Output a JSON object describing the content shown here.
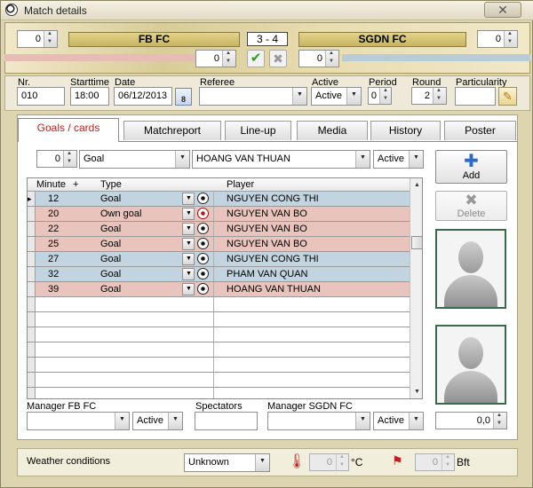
{
  "window": {
    "title": "Match details",
    "close_label": "✕"
  },
  "score": {
    "home_team": "FB FC",
    "away_team": "SGDN FC",
    "score_text": "3  - 4",
    "home_left_spin": "0",
    "away_right_spin": "0",
    "home_sub_spin": "0",
    "away_sub_spin": "0",
    "ok_icon": "✔",
    "cancel_icon": "✖"
  },
  "info": {
    "nr_label": "Nr.",
    "nr_value": "010",
    "starttime_label": "Starttime",
    "starttime_value": "18:00",
    "date_label": "Date",
    "date_value": "06/12/2013",
    "calendar_icon_text": "8",
    "referee_label": "Referee",
    "referee_value": "",
    "active_label": "Active",
    "active_value": "Active",
    "period_label": "Period",
    "period_value": "0",
    "round_label": "Round",
    "round_value": "2",
    "particularity_label": "Particularity",
    "particularity_value": ""
  },
  "tabs": [
    {
      "label": "Goals / cards",
      "active": true
    },
    {
      "label": "Matchreport",
      "active": false
    },
    {
      "label": "Line-up",
      "active": false
    },
    {
      "label": "Media",
      "active": false
    },
    {
      "label": "History",
      "active": false
    },
    {
      "label": "Poster",
      "active": false
    }
  ],
  "filter": {
    "minute_value": "0",
    "type_value": "Goal",
    "player_value": "HOANG VAN THUAN",
    "active_value": "Active"
  },
  "grid": {
    "columns": {
      "minute": "Minute",
      "sort": "+",
      "type": "Type",
      "player": "Player"
    },
    "rows": [
      {
        "minute": "12",
        "type": "Goal",
        "player": "NGUYEN CONG THI",
        "side": "blue",
        "own": false
      },
      {
        "minute": "20",
        "type": "Own goal",
        "player": "NGUYEN VAN BO",
        "side": "pink",
        "own": true
      },
      {
        "minute": "22",
        "type": "Goal",
        "player": "NGUYEN VAN BO",
        "side": "pink",
        "own": false
      },
      {
        "minute": "25",
        "type": "Goal",
        "player": "NGUYEN VAN BO",
        "side": "pink",
        "own": false
      },
      {
        "minute": "27",
        "type": "Goal",
        "player": "NGUYEN CONG THI",
        "side": "blue",
        "own": false
      },
      {
        "minute": "32",
        "type": "Goal",
        "player": "PHAM VAN QUAN",
        "side": "blue",
        "own": false
      },
      {
        "minute": "39",
        "type": "Goal",
        "player": "HOANG VAN THUAN",
        "side": "pink",
        "own": false
      }
    ]
  },
  "buttons": {
    "add_label": "Add",
    "delete_label": "Delete"
  },
  "bottom": {
    "manager_home_label": "Manager FB FC",
    "manager_home_value": "",
    "manager_home_active": "Active",
    "spectators_label": "Spectators",
    "spectators_value": "",
    "manager_away_label": "Manager SGDN FC",
    "manager_away_value": "",
    "manager_away_active": "Active",
    "rating_value": "0,0"
  },
  "weather": {
    "label": "Weather conditions",
    "condition_value": "Unknown",
    "temp_value": "0",
    "temp_unit": "°C",
    "wind_value": "0",
    "wind_unit": "Bft"
  },
  "colors": {
    "home_row": "#e9c4bc",
    "away_row": "#c2d4e0",
    "active_tab_text": "#c02020"
  }
}
